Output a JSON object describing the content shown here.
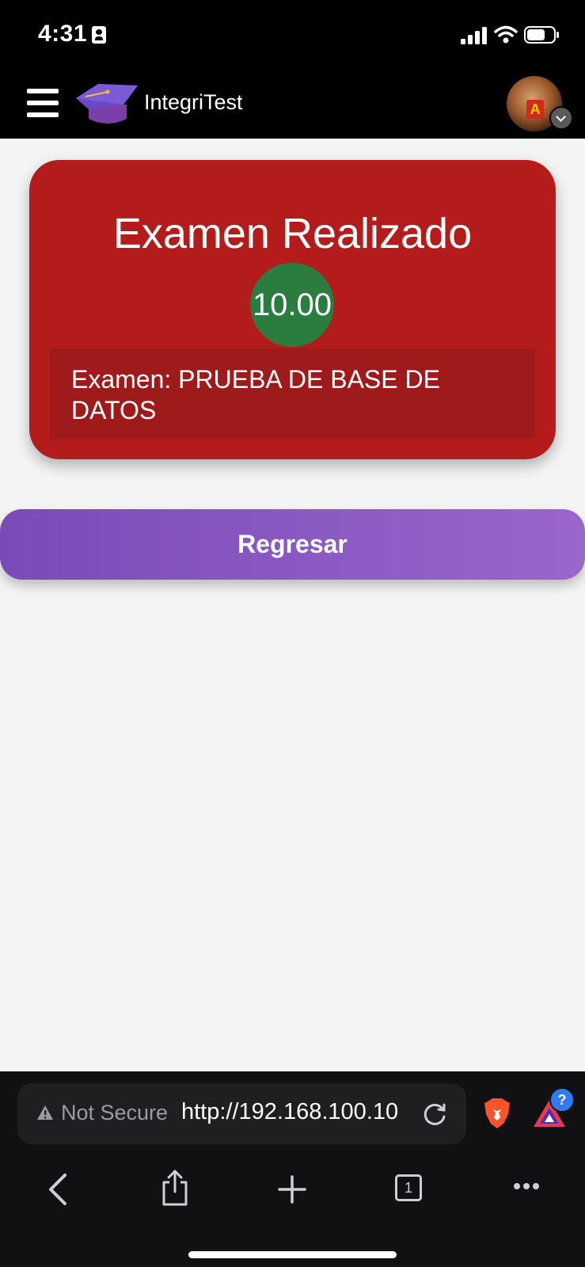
{
  "status_bar": {
    "time": "4:31",
    "icons": [
      "contact-card-icon",
      "signal-icon",
      "wifi-icon",
      "battery-icon"
    ]
  },
  "header": {
    "app_name": "IntegriTest",
    "icons": [
      "menu-icon",
      "graduation-cap-icon",
      "avatar",
      "chevron-down-icon"
    ]
  },
  "result": {
    "title": "Examen Realizado",
    "score": "10.00",
    "exam_label": "Examen: PRUEBA DE BASE DE DATOS"
  },
  "actions": {
    "back_label": "Regresar"
  },
  "browser": {
    "security_label": "Not Secure",
    "url": "http://192.168.100.10",
    "tab_count": "1",
    "help_badge": "?"
  },
  "colors": {
    "card_red": "#b41c1c",
    "score_green": "#2a7d3f",
    "button_purple": "#8a5ac4",
    "page_bg": "#f4f4f4"
  }
}
